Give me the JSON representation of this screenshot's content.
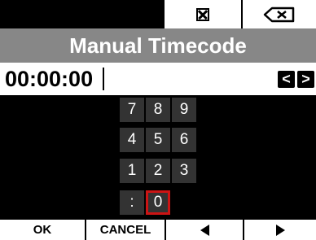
{
  "title": "Manual Timecode",
  "timecode": {
    "value": "00:00:00"
  },
  "top_bar": {
    "clear_icon": "clear-box-icon",
    "backspace_icon": "backspace-icon"
  },
  "cursor_buttons": {
    "left_label": "<",
    "right_label": ">"
  },
  "keypad": {
    "keys": [
      "7",
      "8",
      "9",
      "4",
      "5",
      "6",
      "1",
      "2",
      "3",
      ":",
      "0"
    ],
    "selected": "0"
  },
  "bottom_bar": {
    "ok_label": "OK",
    "cancel_label": "CANCEL",
    "prev_icon": "triangle-left-icon",
    "next_icon": "triangle-right-icon"
  },
  "colors": {
    "background": "#000000",
    "title_bar": "#878787",
    "key_bg": "#333333",
    "selected_outline": "#cc1414"
  }
}
